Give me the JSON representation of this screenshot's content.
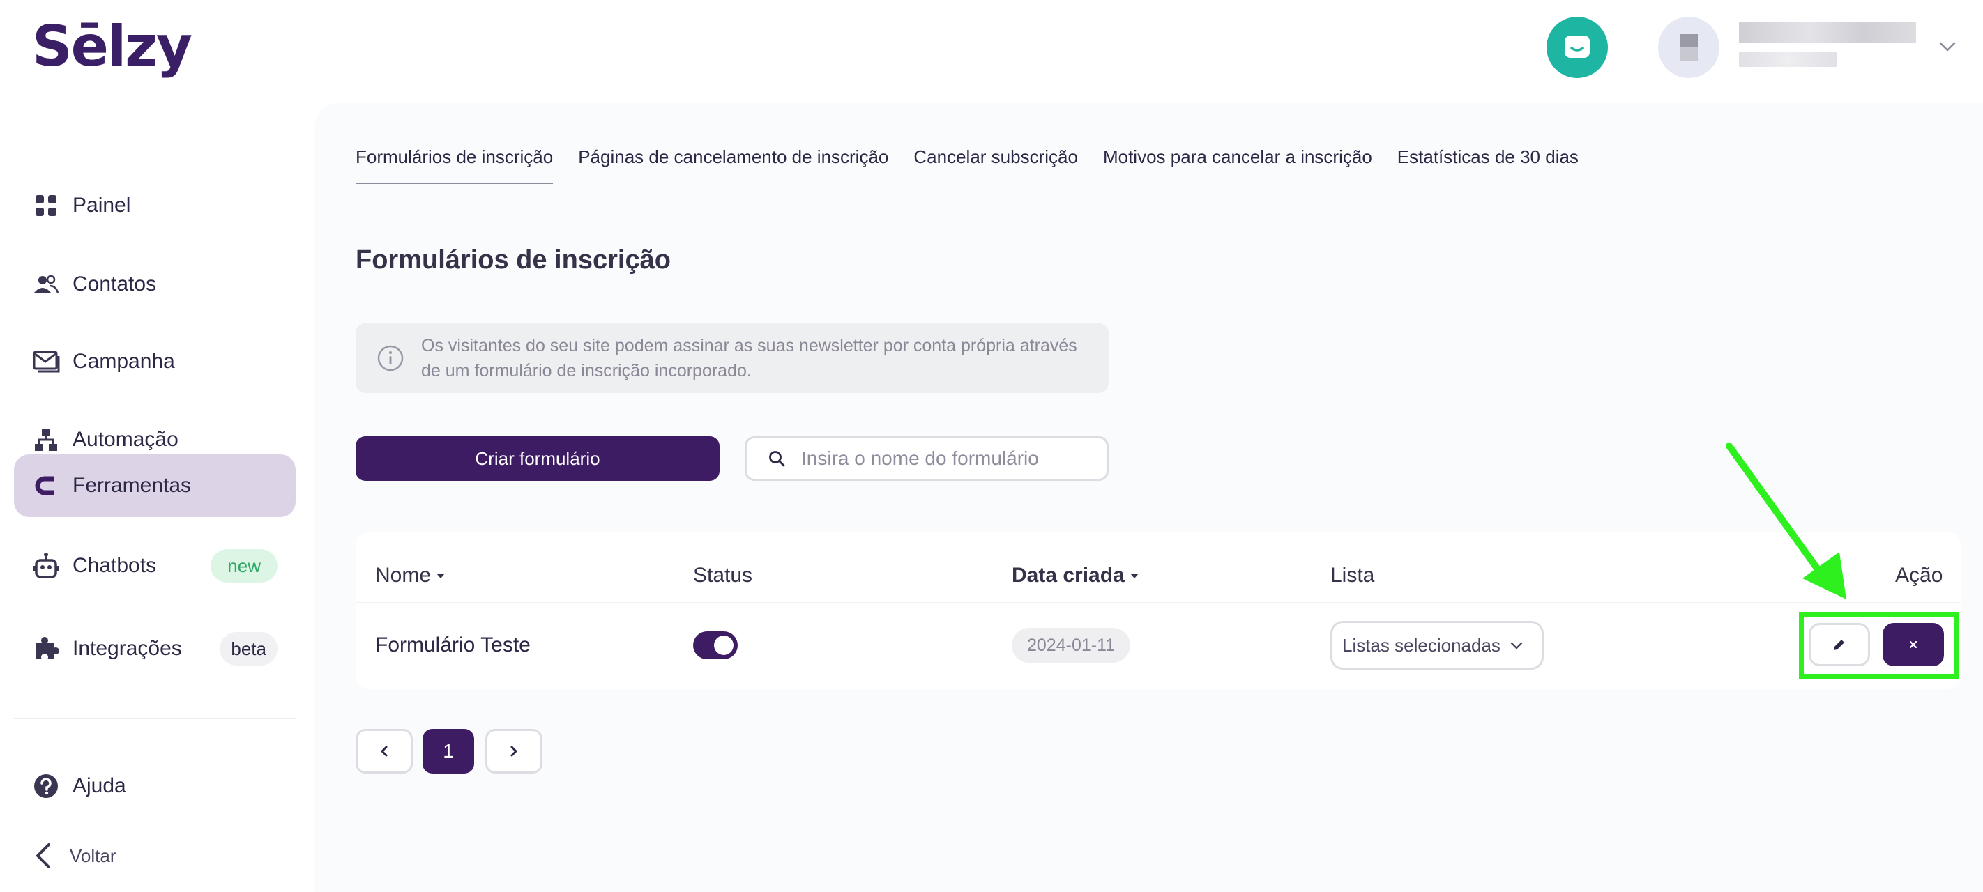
{
  "brand": {
    "logo_text": "Sēlzy"
  },
  "colors": {
    "brand_purple": "#3d1c63",
    "chat_teal": "#1fb5a3",
    "annotation_green": "#2ef01e",
    "active_nav_bg": "#dcd4e6"
  },
  "header": {
    "chat_icon": "chat-bubble-icon",
    "user_menu_icon": "chevron-down-icon"
  },
  "sidebar": {
    "items": [
      {
        "label": "Painel",
        "icon": "dashboard-grid-icon"
      },
      {
        "label": "Contatos",
        "icon": "contacts-icon"
      },
      {
        "label": "Campanha",
        "icon": "campaign-mail-icon"
      },
      {
        "label": "Automação",
        "icon": "automation-icon"
      },
      {
        "label": "Ferramentas",
        "icon": "tools-magnet-icon",
        "active": true
      },
      {
        "label": "Chatbots",
        "icon": "chatbot-icon",
        "badge": "new"
      },
      {
        "label": "Integrações",
        "icon": "puzzle-icon",
        "badge": "beta"
      }
    ],
    "help_label": "Ajuda",
    "back_label": "Voltar"
  },
  "tabs": [
    {
      "label": "Formulários de inscrição",
      "active": true
    },
    {
      "label": "Páginas de cancelamento de inscrição"
    },
    {
      "label": "Cancelar subscrição"
    },
    {
      "label": "Motivos para cancelar a inscrição"
    },
    {
      "label": "Estatísticas de 30 dias"
    }
  ],
  "page": {
    "title": "Formulários de inscrição",
    "info_text": "Os visitantes do seu site podem assinar as suas newsletter por conta própria através de um formulário de inscrição incorporado.",
    "create_button": "Criar formulário",
    "search_placeholder": "Insira o nome do formulário"
  },
  "table": {
    "columns": {
      "name": "Nome",
      "status": "Status",
      "created": "Data criada",
      "list": "Lista",
      "action": "Ação"
    },
    "rows": [
      {
        "name": "Formulário Teste",
        "status_on": true,
        "created": "2024-01-11",
        "list": "Listas selecionadas"
      }
    ]
  },
  "pagination": {
    "current": "1"
  }
}
